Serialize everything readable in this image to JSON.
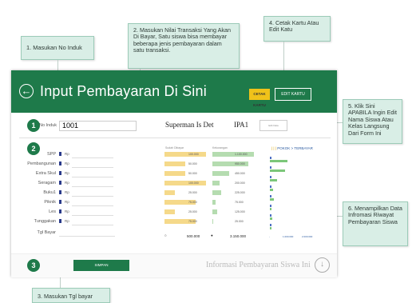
{
  "annotations": {
    "a1": "1. Masukan No Induk",
    "a2": "2. Masukan Nilai Transaksi Yang Akan Di Bayar, Satu siswa bisa membayar beberapa jenis pembayaran dalam satu transaksi.",
    "a3": "3. Masukan Tgl bayar",
    "a4": "4. Cetak Kartu Atau Edit Katu",
    "a5": "5. Klik Sini APABILA Ingin Edit Nama Siswa Atau Kelas Langsung Dari Form Ini",
    "a6": "6. Menampilkan Data Infromasi Riwayat Pembayaran Siswa"
  },
  "header": {
    "back_icon": "arrow-left-circle-icon",
    "title": "Input Pembayaran Di Sini",
    "cetak_label": "CETAK KARTU",
    "edit_label": "EDIT KARTU",
    "accent": "#1e7a4a",
    "cetak_color": "#f0c21a"
  },
  "steps": [
    "1",
    "2",
    "3"
  ],
  "form": {
    "noinduk_label": "No Induk",
    "noinduk_value": "1001",
    "student_name": "Superman Is Det",
    "student_class": "IPA1",
    "edit_data_label": "Edit Data",
    "currency": "Rp",
    "rows": [
      "SPP",
      "Pembangunan",
      "Extra Skul",
      "Seragam",
      "Buku1",
      "Piknik",
      "Les",
      "Tunggakan"
    ],
    "tgl_label": "Tgl Bayar",
    "save_label": "SIMPAN"
  },
  "history": {
    "col_paid": "Sudah Dibayar",
    "col_remaining": "Kekurangan",
    "paid": [
      "100.000",
      "50.000",
      "50.000",
      "100.000",
      "25.000",
      "75.000",
      "25.000",
      "75.000"
    ],
    "remaining": [
      "1.100.000",
      "950.000",
      "450.000",
      "200.000",
      "225.000",
      "75.000",
      "125.000",
      "25.000"
    ],
    "total_paid": "500.000",
    "total_remaining": "3.150.000",
    "legend_label": "POKOK > TERBAYAR",
    "axis_labels": [
      "-",
      "1.000.000",
      "2.000.000"
    ]
  },
  "footer": {
    "info": "Informasi Pembayaran Siswa Ini",
    "down_icon": "chevron-down-circle-icon"
  }
}
